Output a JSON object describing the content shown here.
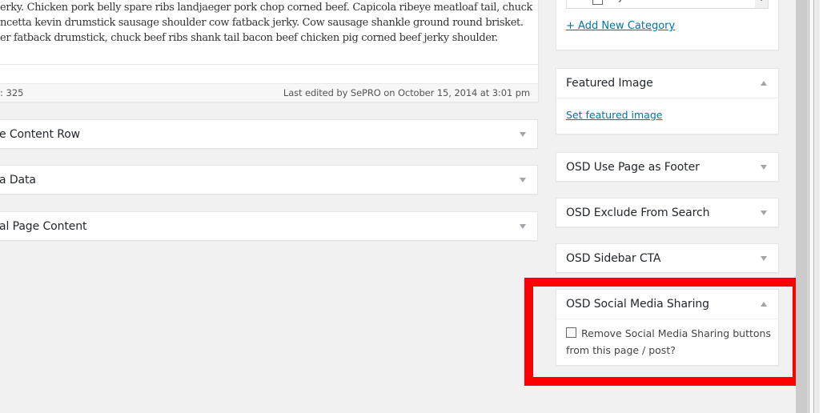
{
  "editor": {
    "lines": [
      "erky. Chicken pork belly spare ribs landjaeger pork chop corned beef. Capicola ribeye meatloaf tail, chuck",
      "ncetta kevin drumstick sausage shoulder cow fatback jerky. Cow sausage shankle ground round brisket.",
      "er fatback drumstick, chuck beef ribs shank tail bacon beef chicken pig corned beef jerky shoulder."
    ],
    "word_count": ": 325",
    "last_edited": "Last edited by SePRO on October 15, 2014 at 3:01 pm"
  },
  "main_boxes": [
    {
      "title": "e Content Row",
      "state": "collapsed"
    },
    {
      "title": "a Data",
      "state": "collapsed"
    },
    {
      "title": "al Page Content",
      "state": "collapsed"
    }
  ],
  "sidebar": {
    "categories": {
      "items": [
        {
          "label": "Cyanobacteria",
          "checked": false
        }
      ],
      "add_new_label": "+ Add New Category"
    },
    "featured_image": {
      "title": "Featured Image",
      "state": "expanded",
      "link_label": "Set featured image"
    },
    "use_page_as_footer": {
      "title": "OSD Use Page as Footer",
      "state": "collapsed"
    },
    "exclude_from_search": {
      "title": "OSD Exclude From Search",
      "state": "collapsed"
    },
    "sidebar_cta": {
      "title": "OSD Sidebar CTA",
      "state": "collapsed"
    },
    "social_media_sharing": {
      "title": "OSD Social Media Sharing",
      "state": "expanded",
      "checkbox_label": "Remove Social Media Sharing buttons from this page / post?",
      "checked": false
    }
  },
  "highlight": {
    "target": "OSD Social Media Sharing",
    "color": "#ff0000"
  },
  "colors": {
    "link": "#0073aa",
    "background": "#f1f1f1",
    "toggle": "#a0a5aa"
  }
}
